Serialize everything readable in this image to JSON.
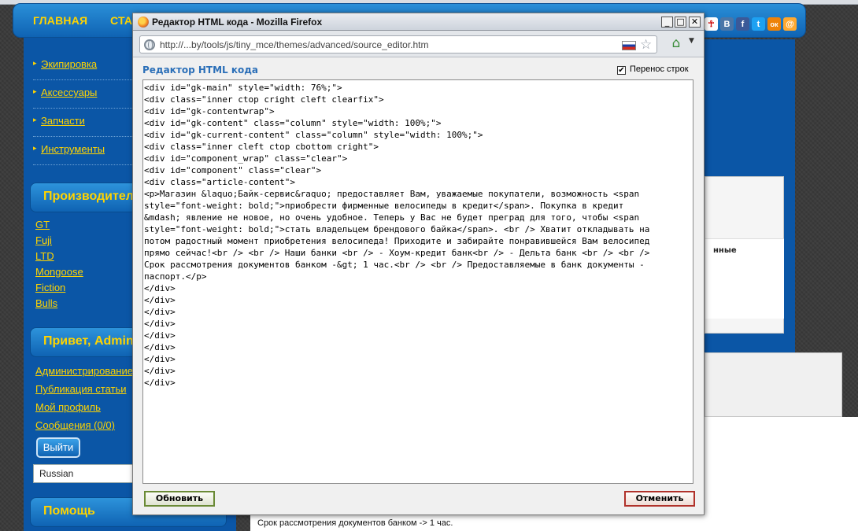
{
  "background_page": {
    "nav": [
      "ГЛАВНАЯ",
      "СТА"
    ],
    "social_icons": [
      {
        "name": "vk-icon",
        "glyph": "В",
        "color": "#4a76a8"
      },
      {
        "name": "facebook-icon",
        "glyph": "f",
        "color": "#3b5998"
      },
      {
        "name": "twitter-icon",
        "glyph": "t",
        "color": "#1da1f2"
      },
      {
        "name": "odnoklassniki-icon",
        "glyph": "ок",
        "color": "#ee8208"
      },
      {
        "name": "mail-icon",
        "glyph": "@",
        "color": "#ffa930"
      }
    ],
    "menu_items": [
      "Экипировка",
      "Аксессуары",
      "Запчасти",
      "Инструменты"
    ],
    "manufacturers_header": "Производители",
    "manufacturers": [
      "GT",
      "Fuji",
      "LTD",
      "Mongoose",
      "Fiction",
      "Bulls"
    ],
    "user_header": "Привет, Admin",
    "user_links": [
      "Администрирование",
      "Публикация статьи",
      "Мой профиль",
      "Сообщения (0/0)"
    ],
    "logout_label": "Выйти",
    "language_value": "Russian",
    "help_header": "Помощь",
    "right_panel_fragment": "нные",
    "bottom_text": "Срок рассмотрения документов банком -> 1 час."
  },
  "popup": {
    "window_title": "Редактор HTML кода - Mozilla Firefox",
    "url": "http://...by/tools/js/tiny_mce/themes/advanced/source_editor.htm",
    "editor_title": "Редактор HTML кода",
    "wrap_label": "Перенос строк",
    "wrap_checked": true,
    "code_lines": [
      "<div id=\"gk-main\" style=\"width: 76%;\">",
      "<div class=\"inner ctop cright cleft clearfix\">",
      "<div id=\"gk-contentwrap\">",
      "<div id=\"gk-content\" class=\"column\" style=\"width: 100%;\">",
      "<div id=\"gk-current-content\" class=\"column\" style=\"width: 100%;\">",
      "<div class=\"inner cleft ctop cbottom cright\">",
      "<div id=\"component_wrap\" class=\"clear\">",
      "<div id=\"component\" class=\"clear\">",
      "<div class=\"article-content\">",
      "<p>Магазин &laquo;Байк-сервис&raquo; предоставляет Вам, уважаемые покупатели, возможность <span",
      "style=\"font-weight: bold;\">приобрести фирменные велосипеды в кредит</span>. Покупка в кредит",
      "&mdash; явление не новое, но очень удобное. Теперь у Вас не будет преград для того, чтобы <span",
      "style=\"font-weight: bold;\">стать владельцем брендового байка</span>. <br /> Хватит откладывать на",
      "потом радостный момент приобретения велосипеда! Приходите и забирайте понравившейся Вам велосипед",
      "прямо сейчас!<br /> <br /> Наши банки <br /> - Хоум-кредит банк<br /> - Дельта банк <br /> <br />",
      "Срок рассмотрения документов банком -&gt; 1 час.<br /> <br /> Предоставляемые в банк документы -",
      "паспорт.</p>",
      "</div>",
      "</div>",
      "</div>",
      "</div>",
      "</div>",
      "</div>",
      "</div>",
      "</div>",
      "</div>"
    ],
    "update_label": "Обновить",
    "cancel_label": "Отменить"
  }
}
